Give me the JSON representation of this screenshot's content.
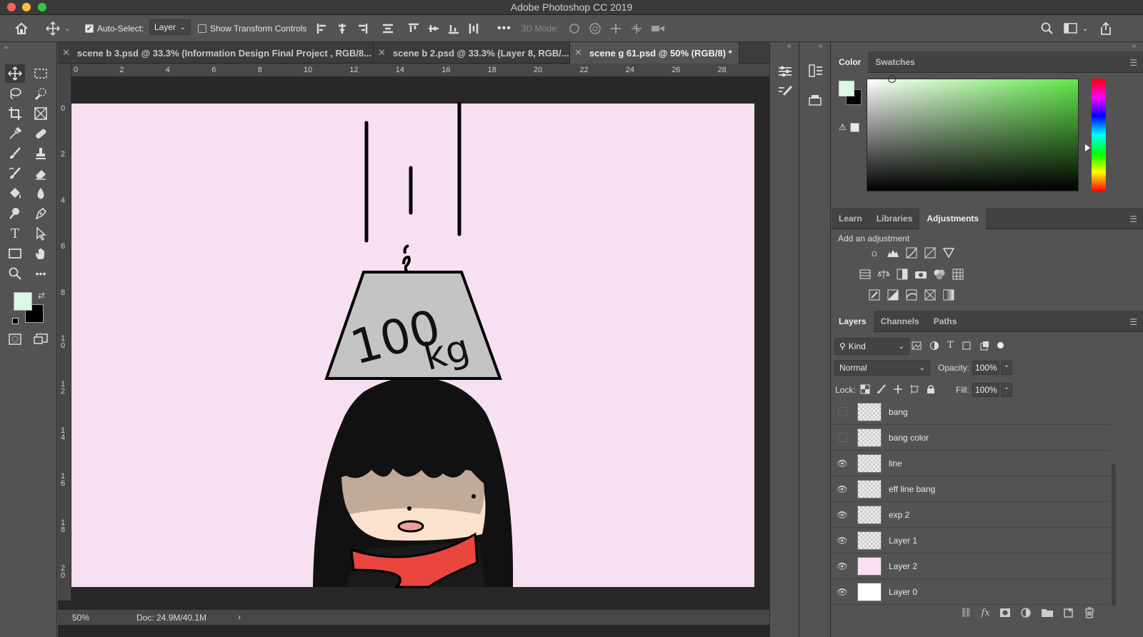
{
  "window": {
    "title": "Adobe Photoshop CC 2019"
  },
  "options_bar": {
    "auto_select_label": "Auto-Select:",
    "auto_select_checked": true,
    "auto_select_value": "Layer",
    "show_transform_label": "Show Transform Controls",
    "show_transform_checked": false,
    "mode_3d_label": "3D Mode:"
  },
  "tabs": [
    {
      "label": "scene b 3.psd @ 33.3% (Information Design Final Project , RGB/8...",
      "active": false
    },
    {
      "label": "scene b 2.psd @ 33.3% (Layer 8, RGB/...",
      "active": false
    },
    {
      "label": "scene g 61.psd @ 50% (RGB/8) *",
      "active": true
    }
  ],
  "rulers": {
    "horizontal": [
      "0",
      "2",
      "4",
      "6",
      "8",
      "10",
      "12",
      "14",
      "16",
      "18",
      "20",
      "22",
      "24",
      "26",
      "28"
    ],
    "vertical": [
      "0",
      "2",
      "4",
      "6",
      "8",
      "10",
      "12",
      "14",
      "16",
      "18",
      "20"
    ]
  },
  "artwork": {
    "weight_label": "100",
    "weight_unit": "kg"
  },
  "status": {
    "zoom": "50%",
    "doc": "Doc: 24.9M/40.1M",
    "arrow": "›"
  },
  "color_panel": {
    "tabs": [
      "Color",
      "Swatches"
    ],
    "active_tab": "Color",
    "foreground": "#dcf8e4",
    "background": "#000000",
    "hue_color": "#62e84a"
  },
  "adjustments_panel": {
    "tabs": [
      "Learn",
      "Libraries",
      "Adjustments"
    ],
    "active_tab": "Adjustments",
    "heading": "Add an adjustment"
  },
  "layers_panel": {
    "tabs": [
      "Layers",
      "Channels",
      "Paths"
    ],
    "active_tab": "Layers",
    "filter_label": "Kind",
    "blend_mode": "Normal",
    "opacity_label": "Opacity:",
    "opacity_value": "100%",
    "lock_label": "Lock:",
    "fill_label": "Fill:",
    "fill_value": "100%",
    "layers": [
      {
        "name": "bang",
        "visible": false,
        "thumb": "transparent"
      },
      {
        "name": "bang color",
        "visible": false,
        "thumb": "transparent-dot"
      },
      {
        "name": "line",
        "visible": true,
        "thumb": "transparent"
      },
      {
        "name": "eff line bang",
        "visible": true,
        "thumb": "transparent"
      },
      {
        "name": "exp 2",
        "visible": true,
        "thumb": "transparent-dot"
      },
      {
        "name": "Layer 1",
        "visible": true,
        "thumb": "figure"
      },
      {
        "name": "Layer 2",
        "visible": true,
        "thumb": "#f8dff1"
      },
      {
        "name": "Layer 0",
        "visible": true,
        "thumb": "#ffffff"
      }
    ]
  },
  "colors": {
    "canvas_bg": "#f8e0f3",
    "hair": "#111111",
    "weight": "#c4c4c4",
    "skin_shadow": "#c1aa98",
    "skin": "#fbe2cd",
    "scarf": "#e8463e",
    "mouth": "#f29b9b"
  }
}
